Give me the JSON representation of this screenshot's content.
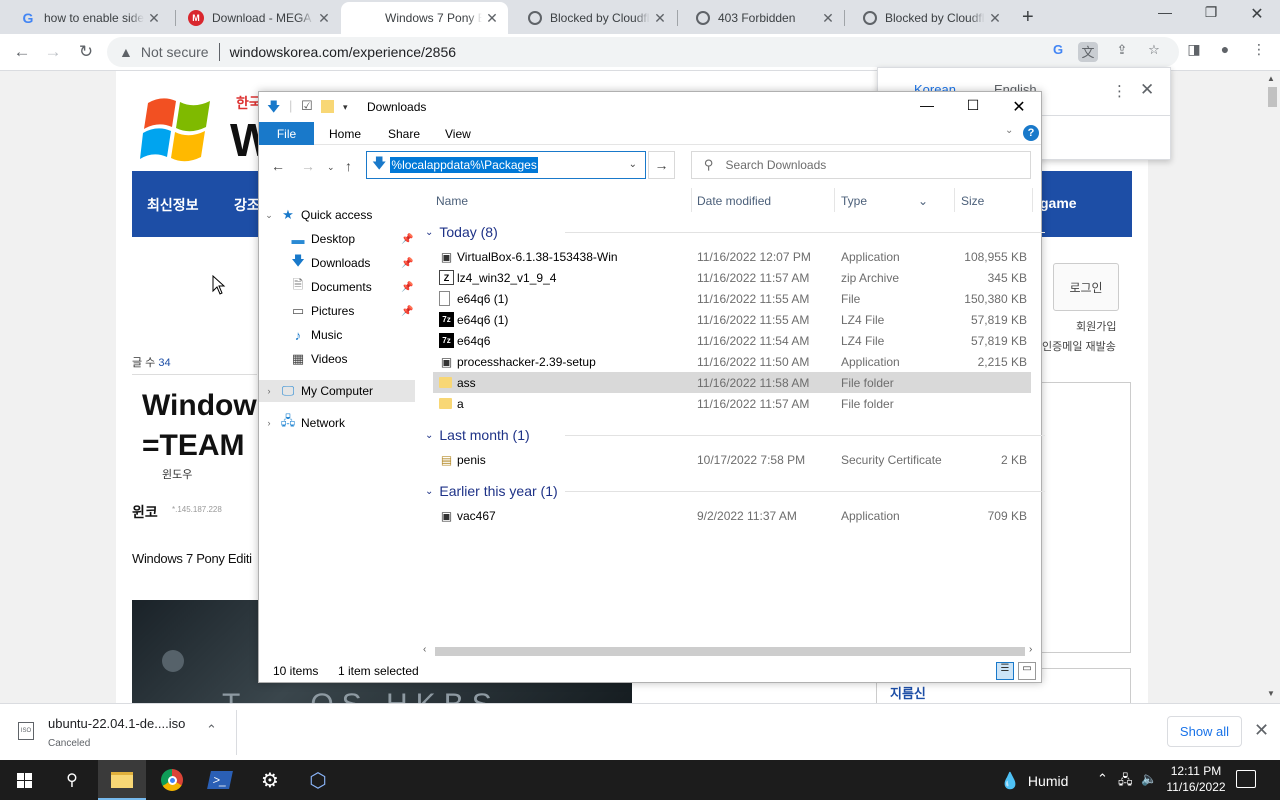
{
  "browser": {
    "tabs": [
      {
        "title": "how to enable side",
        "icon": "google-icon",
        "active": false
      },
      {
        "title": "Download - MEGA",
        "icon": "mega-icon",
        "active": false
      },
      {
        "title": "Windows 7 Pony Ed",
        "icon": "windows-icon",
        "active": true
      },
      {
        "title": "Blocked by Cloudfl",
        "icon": "globe-icon",
        "active": false
      },
      {
        "title": "403 Forbidden",
        "icon": "globe-icon",
        "active": false
      },
      {
        "title": "Blocked by Cloudfl",
        "icon": "globe-icon",
        "active": false
      }
    ],
    "security_label": "Not secure",
    "url": "windowskorea.com/experience/2856"
  },
  "translate_popup": {
    "source_lang": "Korean",
    "target_lang": "English"
  },
  "site": {
    "logo_korean": "한국",
    "logo_letter": "W",
    "nav_items": [
      "최신정보",
      "강조",
      "game"
    ],
    "post_count_label": "글 수",
    "post_count": "34",
    "title_line1": "Window",
    "title_line2": "=TEAM",
    "subtitle": "윈도우",
    "author": "윈코",
    "author_ip": "*.145.187.228",
    "description": "Windows 7 Pony Editi",
    "image_text": "T... OS HKBS",
    "login_button": "로그인",
    "join_link": "회원가입",
    "resend_link": "인증메일 재발송",
    "right_title": "지름신"
  },
  "explorer": {
    "title": "Downloads",
    "ribbon_tabs": [
      "File",
      "Home",
      "Share",
      "View"
    ],
    "help": "?",
    "address_path": "%localappdata%\\Packages",
    "search_placeholder": "Search Downloads",
    "nav": [
      {
        "label": "Quick access",
        "icon": "star-icon",
        "pinned": false,
        "level": 0
      },
      {
        "label": "Desktop",
        "icon": "desktop-icon",
        "pinned": true,
        "level": 1
      },
      {
        "label": "Downloads",
        "icon": "download-arrow-icon",
        "pinned": true,
        "level": 1
      },
      {
        "label": "Documents",
        "icon": "document-icon",
        "pinned": true,
        "level": 1
      },
      {
        "label": "Pictures",
        "icon": "pictures-icon",
        "pinned": true,
        "level": 1
      },
      {
        "label": "Music",
        "icon": "music-icon",
        "pinned": false,
        "level": 1
      },
      {
        "label": "Videos",
        "icon": "videos-icon",
        "pinned": false,
        "level": 1
      },
      {
        "label": "My Computer",
        "icon": "computer-icon",
        "pinned": false,
        "level": 0
      },
      {
        "label": "Network",
        "icon": "network-icon",
        "pinned": false,
        "level": 0
      }
    ],
    "columns": [
      "Name",
      "Date modified",
      "Type",
      "Size"
    ],
    "groups": [
      {
        "label": "Today (8)",
        "files": [
          {
            "name": "VirtualBox-6.1.38-153438-Win",
            "date": "11/16/2022 12:07 PM",
            "type": "Application",
            "size": "108,955 KB",
            "icon": "app"
          },
          {
            "name": "lz4_win32_v1_9_4",
            "date": "11/16/2022 11:57 AM",
            "type": "zip Archive",
            "size": "345 KB",
            "icon": "zip"
          },
          {
            "name": "e64q6 (1)",
            "date": "11/16/2022 11:55 AM",
            "type": "File",
            "size": "150,380 KB",
            "icon": "file"
          },
          {
            "name": "e64q6 (1)",
            "date": "11/16/2022 11:55 AM",
            "type": "LZ4 File",
            "size": "57,819 KB",
            "icon": "7z"
          },
          {
            "name": "e64q6",
            "date": "11/16/2022 11:54 AM",
            "type": "LZ4 File",
            "size": "57,819 KB",
            "icon": "7z"
          },
          {
            "name": "processhacker-2.39-setup",
            "date": "11/16/2022 11:50 AM",
            "type": "Application",
            "size": "2,215 KB",
            "icon": "app"
          },
          {
            "name": "ass",
            "date": "11/16/2022 11:58 AM",
            "type": "File folder",
            "size": "",
            "icon": "folder",
            "selected": true
          },
          {
            "name": "a",
            "date": "11/16/2022 11:57 AM",
            "type": "File folder",
            "size": "",
            "icon": "folder"
          }
        ]
      },
      {
        "label": "Last month (1)",
        "files": [
          {
            "name": "penis",
            "date": "10/17/2022 7:58 PM",
            "type": "Security Certificate",
            "size": "2 KB",
            "icon": "cert"
          }
        ]
      },
      {
        "label": "Earlier this year (1)",
        "files": [
          {
            "name": "vac467",
            "date": "9/2/2022 11:37 AM",
            "type": "Application",
            "size": "709 KB",
            "icon": "app"
          }
        ]
      }
    ],
    "status_items": "10 items",
    "status_selected": "1 item selected"
  },
  "download_shelf": {
    "filename": "ubuntu-22.04.1-de....iso",
    "status": "Canceled",
    "file_badge": "ISO",
    "show_all": "Show all"
  },
  "taskbar": {
    "weather": "Humid",
    "time": "12:11 PM",
    "date": "11/16/2022"
  },
  "colors": {
    "explorer_accent": "#1979ca",
    "site_nav": "#1d4ea6",
    "selection_blue": "#0078d7",
    "taskbar": "#1c1c1c"
  }
}
